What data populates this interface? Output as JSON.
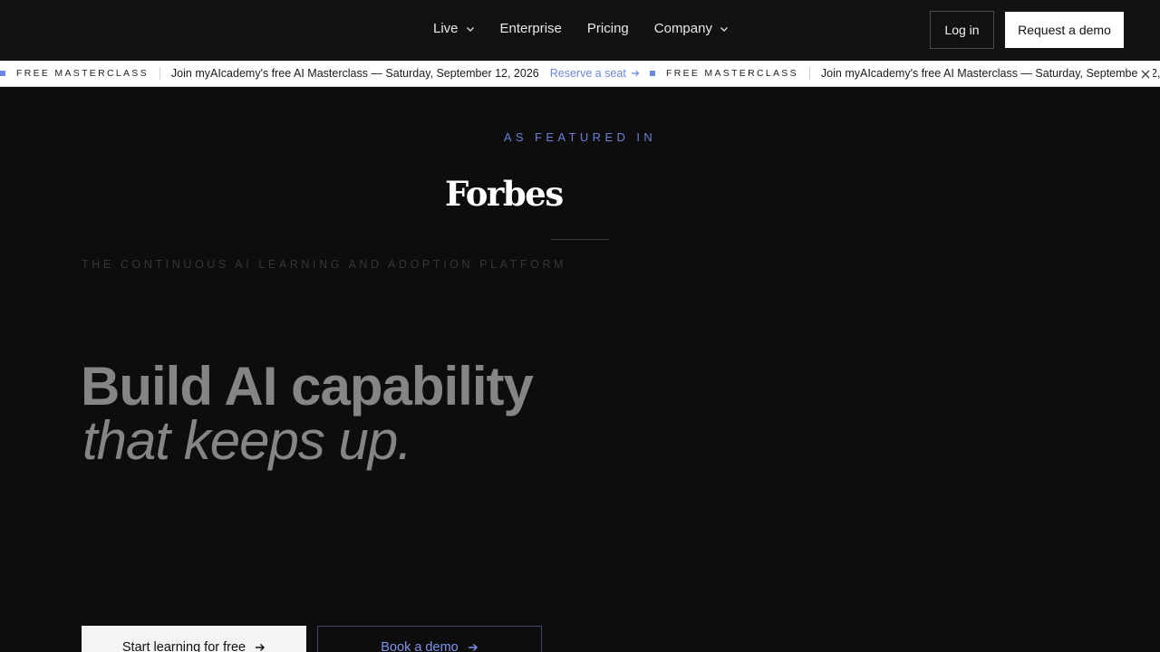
{
  "nav": {
    "links": [
      {
        "label": "Live",
        "has_dropdown": true
      },
      {
        "label": "Enterprise",
        "has_dropdown": false
      },
      {
        "label": "Pricing",
        "has_dropdown": false
      },
      {
        "label": "Company",
        "has_dropdown": true
      }
    ],
    "login_label": "Log in",
    "demo_label": "Request a demo"
  },
  "announcement": {
    "tag": "FREE MASTERCLASS",
    "message": "Join myAIcademy's free AI Masterclass — Saturday, September 12, 2026",
    "message_truncated": "Join myAIcademy's free AI Masterclass — Saturday, September 12,",
    "cta": "Reserve a seat",
    "accent_color": "#6b85e0"
  },
  "hero": {
    "featured_label": "AS FEATURED IN",
    "featured_logo": "Forbes",
    "platform_label": "THE CONTINUOUS AI LEARNING AND ADOPTION PLATFORM",
    "headline_line1": "Build AI capability",
    "headline_line2": "that keeps up.",
    "primary_cta": "Start learning for free",
    "secondary_cta": "Book a demo"
  },
  "icons": {
    "dropdown": "chevron-down-icon",
    "arrow": "arrow-right-icon",
    "close": "close-icon"
  }
}
